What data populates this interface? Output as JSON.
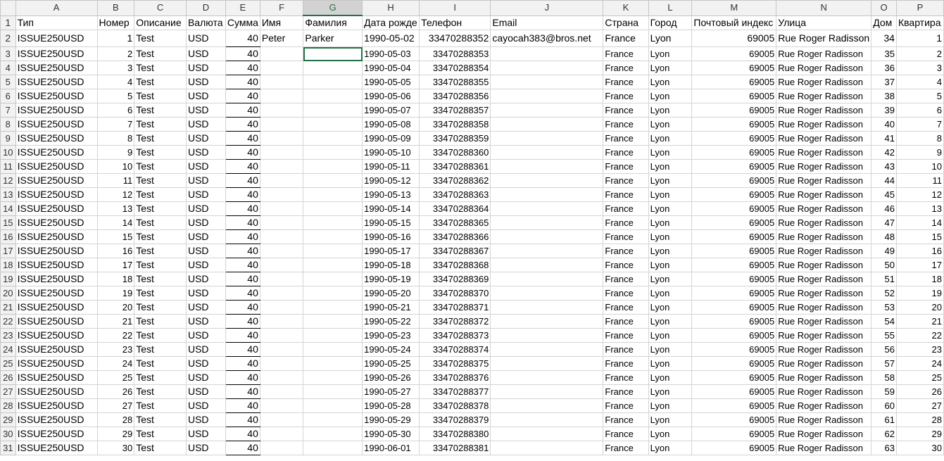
{
  "columns": [
    "A",
    "B",
    "C",
    "D",
    "E",
    "F",
    "G",
    "H",
    "I",
    "J",
    "K",
    "L",
    "M",
    "N",
    "O",
    "P"
  ],
  "headers": [
    "Тип",
    "Номер",
    "Описание",
    "Валюта",
    "Сумма",
    "Имя",
    "Фамилия",
    "Дата рожде",
    "Телефон",
    "Email",
    "Страна",
    "Город",
    "Почтовый индекс",
    "Улица",
    "Дом",
    "Квартира"
  ],
  "rows": [
    {
      "r": "2",
      "a": "ISSUE250USD",
      "b": "1",
      "c": "Test",
      "d": "USD",
      "e": "40",
      "f": "Peter",
      "g": "Parker",
      "h": "1990-05-02",
      "i": "33470288352",
      "j": "cayocah383@bros.net",
      "k": "France",
      "l": "Lyon",
      "m": "69005",
      "n": "Rue Roger Radisson",
      "o": "34",
      "p": "1"
    },
    {
      "r": "3",
      "a": "ISSUE250USD",
      "b": "2",
      "c": "Test",
      "d": "USD",
      "e": "40",
      "f": "",
      "g": "",
      "h": "1990-05-03",
      "i": "33470288353",
      "j": "",
      "k": "France",
      "l": "Lyon",
      "m": "69005",
      "n": "Rue Roger Radisson",
      "o": "35",
      "p": "2"
    },
    {
      "r": "4",
      "a": "ISSUE250USD",
      "b": "3",
      "c": "Test",
      "d": "USD",
      "e": "40",
      "f": "",
      "g": "",
      "h": "1990-05-04",
      "i": "33470288354",
      "j": "",
      "k": "France",
      "l": "Lyon",
      "m": "69005",
      "n": "Rue Roger Radisson",
      "o": "36",
      "p": "3"
    },
    {
      "r": "5",
      "a": "ISSUE250USD",
      "b": "4",
      "c": "Test",
      "d": "USD",
      "e": "40",
      "f": "",
      "g": "",
      "h": "1990-05-05",
      "i": "33470288355",
      "j": "",
      "k": "France",
      "l": "Lyon",
      "m": "69005",
      "n": "Rue Roger Radisson",
      "o": "37",
      "p": "4"
    },
    {
      "r": "6",
      "a": "ISSUE250USD",
      "b": "5",
      "c": "Test",
      "d": "USD",
      "e": "40",
      "f": "",
      "g": "",
      "h": "1990-05-06",
      "i": "33470288356",
      "j": "",
      "k": "France",
      "l": "Lyon",
      "m": "69005",
      "n": "Rue Roger Radisson",
      "o": "38",
      "p": "5"
    },
    {
      "r": "7",
      "a": "ISSUE250USD",
      "b": "6",
      "c": "Test",
      "d": "USD",
      "e": "40",
      "f": "",
      "g": "",
      "h": "1990-05-07",
      "i": "33470288357",
      "j": "",
      "k": "France",
      "l": "Lyon",
      "m": "69005",
      "n": "Rue Roger Radisson",
      "o": "39",
      "p": "6"
    },
    {
      "r": "8",
      "a": "ISSUE250USD",
      "b": "7",
      "c": "Test",
      "d": "USD",
      "e": "40",
      "f": "",
      "g": "",
      "h": "1990-05-08",
      "i": "33470288358",
      "j": "",
      "k": "France",
      "l": "Lyon",
      "m": "69005",
      "n": "Rue Roger Radisson",
      "o": "40",
      "p": "7"
    },
    {
      "r": "9",
      "a": "ISSUE250USD",
      "b": "8",
      "c": "Test",
      "d": "USD",
      "e": "40",
      "f": "",
      "g": "",
      "h": "1990-05-09",
      "i": "33470288359",
      "j": "",
      "k": "France",
      "l": "Lyon",
      "m": "69005",
      "n": "Rue Roger Radisson",
      "o": "41",
      "p": "8"
    },
    {
      "r": "10",
      "a": "ISSUE250USD",
      "b": "9",
      "c": "Test",
      "d": "USD",
      "e": "40",
      "f": "",
      "g": "",
      "h": "1990-05-10",
      "i": "33470288360",
      "j": "",
      "k": "France",
      "l": "Lyon",
      "m": "69005",
      "n": "Rue Roger Radisson",
      "o": "42",
      "p": "9"
    },
    {
      "r": "11",
      "a": "ISSUE250USD",
      "b": "10",
      "c": "Test",
      "d": "USD",
      "e": "40",
      "f": "",
      "g": "",
      "h": "1990-05-11",
      "i": "33470288361",
      "j": "",
      "k": "France",
      "l": "Lyon",
      "m": "69005",
      "n": "Rue Roger Radisson",
      "o": "43",
      "p": "10"
    },
    {
      "r": "12",
      "a": "ISSUE250USD",
      "b": "11",
      "c": "Test",
      "d": "USD",
      "e": "40",
      "f": "",
      "g": "",
      "h": "1990-05-12",
      "i": "33470288362",
      "j": "",
      "k": "France",
      "l": "Lyon",
      "m": "69005",
      "n": "Rue Roger Radisson",
      "o": "44",
      "p": "11"
    },
    {
      "r": "13",
      "a": "ISSUE250USD",
      "b": "12",
      "c": "Test",
      "d": "USD",
      "e": "40",
      "f": "",
      "g": "",
      "h": "1990-05-13",
      "i": "33470288363",
      "j": "",
      "k": "France",
      "l": "Lyon",
      "m": "69005",
      "n": "Rue Roger Radisson",
      "o": "45",
      "p": "12"
    },
    {
      "r": "14",
      "a": "ISSUE250USD",
      "b": "13",
      "c": "Test",
      "d": "USD",
      "e": "40",
      "f": "",
      "g": "",
      "h": "1990-05-14",
      "i": "33470288364",
      "j": "",
      "k": "France",
      "l": "Lyon",
      "m": "69005",
      "n": "Rue Roger Radisson",
      "o": "46",
      "p": "13"
    },
    {
      "r": "15",
      "a": "ISSUE250USD",
      "b": "14",
      "c": "Test",
      "d": "USD",
      "e": "40",
      "f": "",
      "g": "",
      "h": "1990-05-15",
      "i": "33470288365",
      "j": "",
      "k": "France",
      "l": "Lyon",
      "m": "69005",
      "n": "Rue Roger Radisson",
      "o": "47",
      "p": "14"
    },
    {
      "r": "16",
      "a": "ISSUE250USD",
      "b": "15",
      "c": "Test",
      "d": "USD",
      "e": "40",
      "f": "",
      "g": "",
      "h": "1990-05-16",
      "i": "33470288366",
      "j": "",
      "k": "France",
      "l": "Lyon",
      "m": "69005",
      "n": "Rue Roger Radisson",
      "o": "48",
      "p": "15"
    },
    {
      "r": "17",
      "a": "ISSUE250USD",
      "b": "16",
      "c": "Test",
      "d": "USD",
      "e": "40",
      "f": "",
      "g": "",
      "h": "1990-05-17",
      "i": "33470288367",
      "j": "",
      "k": "France",
      "l": "Lyon",
      "m": "69005",
      "n": "Rue Roger Radisson",
      "o": "49",
      "p": "16"
    },
    {
      "r": "18",
      "a": "ISSUE250USD",
      "b": "17",
      "c": "Test",
      "d": "USD",
      "e": "40",
      "f": "",
      "g": "",
      "h": "1990-05-18",
      "i": "33470288368",
      "j": "",
      "k": "France",
      "l": "Lyon",
      "m": "69005",
      "n": "Rue Roger Radisson",
      "o": "50",
      "p": "17"
    },
    {
      "r": "19",
      "a": "ISSUE250USD",
      "b": "18",
      "c": "Test",
      "d": "USD",
      "e": "40",
      "f": "",
      "g": "",
      "h": "1990-05-19",
      "i": "33470288369",
      "j": "",
      "k": "France",
      "l": "Lyon",
      "m": "69005",
      "n": "Rue Roger Radisson",
      "o": "51",
      "p": "18"
    },
    {
      "r": "20",
      "a": "ISSUE250USD",
      "b": "19",
      "c": "Test",
      "d": "USD",
      "e": "40",
      "f": "",
      "g": "",
      "h": "1990-05-20",
      "i": "33470288370",
      "j": "",
      "k": "France",
      "l": "Lyon",
      "m": "69005",
      "n": "Rue Roger Radisson",
      "o": "52",
      "p": "19"
    },
    {
      "r": "21",
      "a": "ISSUE250USD",
      "b": "20",
      "c": "Test",
      "d": "USD",
      "e": "40",
      "f": "",
      "g": "",
      "h": "1990-05-21",
      "i": "33470288371",
      "j": "",
      "k": "France",
      "l": "Lyon",
      "m": "69005",
      "n": "Rue Roger Radisson",
      "o": "53",
      "p": "20"
    },
    {
      "r": "22",
      "a": "ISSUE250USD",
      "b": "21",
      "c": "Test",
      "d": "USD",
      "e": "40",
      "f": "",
      "g": "",
      "h": "1990-05-22",
      "i": "33470288372",
      "j": "",
      "k": "France",
      "l": "Lyon",
      "m": "69005",
      "n": "Rue Roger Radisson",
      "o": "54",
      "p": "21"
    },
    {
      "r": "23",
      "a": "ISSUE250USD",
      "b": "22",
      "c": "Test",
      "d": "USD",
      "e": "40",
      "f": "",
      "g": "",
      "h": "1990-05-23",
      "i": "33470288373",
      "j": "",
      "k": "France",
      "l": "Lyon",
      "m": "69005",
      "n": "Rue Roger Radisson",
      "o": "55",
      "p": "22"
    },
    {
      "r": "24",
      "a": "ISSUE250USD",
      "b": "23",
      "c": "Test",
      "d": "USD",
      "e": "40",
      "f": "",
      "g": "",
      "h": "1990-05-24",
      "i": "33470288374",
      "j": "",
      "k": "France",
      "l": "Lyon",
      "m": "69005",
      "n": "Rue Roger Radisson",
      "o": "56",
      "p": "23"
    },
    {
      "r": "25",
      "a": "ISSUE250USD",
      "b": "24",
      "c": "Test",
      "d": "USD",
      "e": "40",
      "f": "",
      "g": "",
      "h": "1990-05-25",
      "i": "33470288375",
      "j": "",
      "k": "France",
      "l": "Lyon",
      "m": "69005",
      "n": "Rue Roger Radisson",
      "o": "57",
      "p": "24"
    },
    {
      "r": "26",
      "a": "ISSUE250USD",
      "b": "25",
      "c": "Test",
      "d": "USD",
      "e": "40",
      "f": "",
      "g": "",
      "h": "1990-05-26",
      "i": "33470288376",
      "j": "",
      "k": "France",
      "l": "Lyon",
      "m": "69005",
      "n": "Rue Roger Radisson",
      "o": "58",
      "p": "25"
    },
    {
      "r": "27",
      "a": "ISSUE250USD",
      "b": "26",
      "c": "Test",
      "d": "USD",
      "e": "40",
      "f": "",
      "g": "",
      "h": "1990-05-27",
      "i": "33470288377",
      "j": "",
      "k": "France",
      "l": "Lyon",
      "m": "69005",
      "n": "Rue Roger Radisson",
      "o": "59",
      "p": "26"
    },
    {
      "r": "28",
      "a": "ISSUE250USD",
      "b": "27",
      "c": "Test",
      "d": "USD",
      "e": "40",
      "f": "",
      "g": "",
      "h": "1990-05-28",
      "i": "33470288378",
      "j": "",
      "k": "France",
      "l": "Lyon",
      "m": "69005",
      "n": "Rue Roger Radisson",
      "o": "60",
      "p": "27"
    },
    {
      "r": "29",
      "a": "ISSUE250USD",
      "b": "28",
      "c": "Test",
      "d": "USD",
      "e": "40",
      "f": "",
      "g": "",
      "h": "1990-05-29",
      "i": "33470288379",
      "j": "",
      "k": "France",
      "l": "Lyon",
      "m": "69005",
      "n": "Rue Roger Radisson",
      "o": "61",
      "p": "28"
    },
    {
      "r": "30",
      "a": "ISSUE250USD",
      "b": "29",
      "c": "Test",
      "d": "USD",
      "e": "40",
      "f": "",
      "g": "",
      "h": "1990-05-30",
      "i": "33470288380",
      "j": "",
      "k": "France",
      "l": "Lyon",
      "m": "69005",
      "n": "Rue Roger Radisson",
      "o": "62",
      "p": "29"
    },
    {
      "r": "31",
      "a": "ISSUE250USD",
      "b": "30",
      "c": "Test",
      "d": "USD",
      "e": "40",
      "f": "",
      "g": "",
      "h": "1990-06-01",
      "i": "33470288381",
      "j": "",
      "k": "France",
      "l": "Lyon",
      "m": "69005",
      "n": "Rue Roger Radisson",
      "o": "63",
      "p": "30"
    }
  ]
}
